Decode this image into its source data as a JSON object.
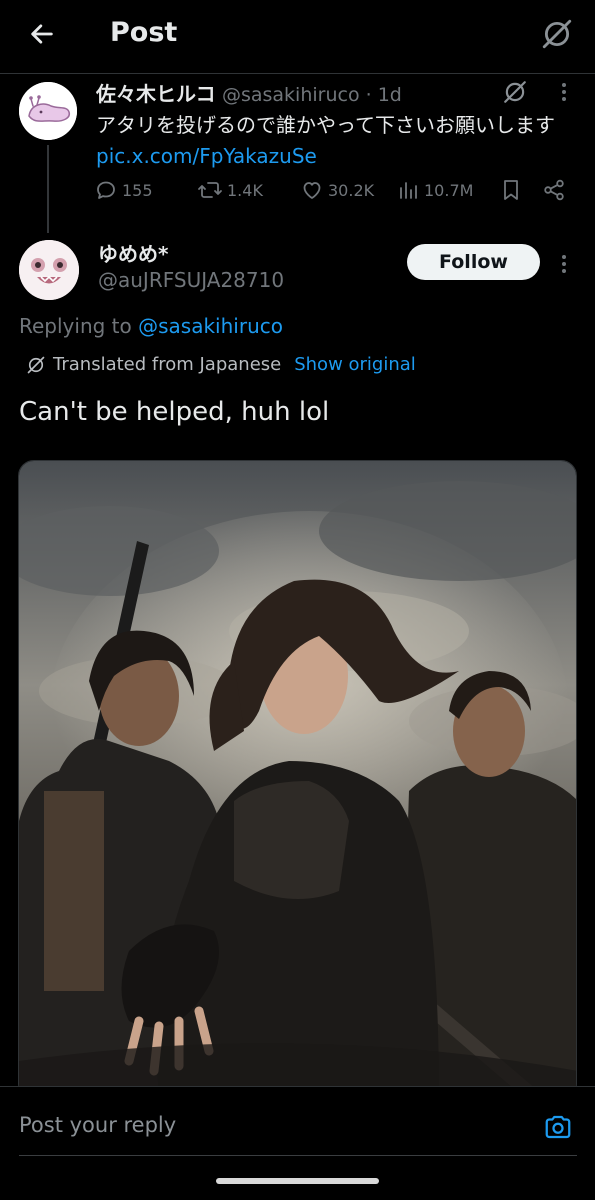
{
  "header": {
    "title": "Post",
    "back_icon": "arrow-left-icon",
    "grok_icon": "grok-slash-icon"
  },
  "parent_post": {
    "author_name": "佐々木ヒルコ",
    "handle": "@sasakihiruco",
    "separator": " · ",
    "time": "1d",
    "text": "アタリを投げるので誰かやって下さいお願いします ",
    "link": "pic.x.com/FpYakazuSe",
    "stats": {
      "replies": "155",
      "reposts": "1.4K",
      "likes": "30.2K",
      "views": "10.7M"
    }
  },
  "reply_post": {
    "author_name": "ゆめめ*",
    "handle": "@auJRFSUJA28710",
    "follow_label": "Follow",
    "replying_prefix": "Replying to ",
    "replying_to": "@sasakihiruco",
    "translated_label": "Translated from Japanese",
    "show_original_label": "Show original",
    "text": "Can't be helped, huh lol"
  },
  "compose": {
    "placeholder": "Post your reply"
  },
  "colors": {
    "background": "#000000",
    "text_primary": "#e7e9ea",
    "text_secondary": "#71767b",
    "accent": "#1d9bf0"
  }
}
